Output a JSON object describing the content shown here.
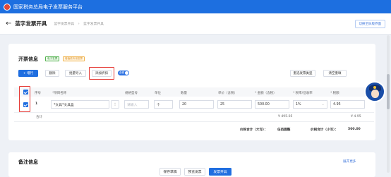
{
  "app": {
    "title": "国家税务总局电子发票服务平台"
  },
  "header": {
    "back_glyph": "←",
    "page_title": "蓝字发票开具",
    "breadcrumb": [
      "蓝字发票开具",
      "蓝字发票开具"
    ],
    "switch_label": "切换至旧版界面"
  },
  "invoice_section": {
    "title": "开票信息",
    "tags": [
      "电子发票",
      "增值税专用发票"
    ],
    "buttons": {
      "add": "+ 增行",
      "delete": "删除",
      "batch_import": "批量导入",
      "add_discount": "添加折扣",
      "toggle": "含税",
      "reselect": "重选发票类型",
      "clear": "清空重填"
    },
    "columns": [
      "序号",
      "*项目名称",
      "规格型号",
      "单位",
      "数量",
      "单价（含税）",
      "* 金额（含税）",
      "* 税率/征收率",
      "* 税额"
    ],
    "rows": [
      {
        "index": "1",
        "item_name": "*文具*文具盒",
        "spec_placeholder": "请输入",
        "unit": "个",
        "quantity": "20",
        "unit_price": "25",
        "amount": "500.00",
        "tax_rate": "1%",
        "tax": "4.95"
      }
    ],
    "subtotal": {
      "label": "合计",
      "amount": "¥ 495.05",
      "tax": "¥ 4.95"
    },
    "total": {
      "upper_label": "价税合计（大写）：",
      "upper_value": "伍佰圆整",
      "lower_label": "价税合计（小写）：",
      "lower_value": "500.00"
    }
  },
  "remark_section": {
    "title": "备注信息",
    "more": "展开更多"
  },
  "footer": {
    "save_draft": "保存草稿",
    "preview": "预览发票",
    "issue": "发票开具"
  },
  "colors": {
    "brand": "#1d6fe0",
    "highlight": "#e53935"
  }
}
